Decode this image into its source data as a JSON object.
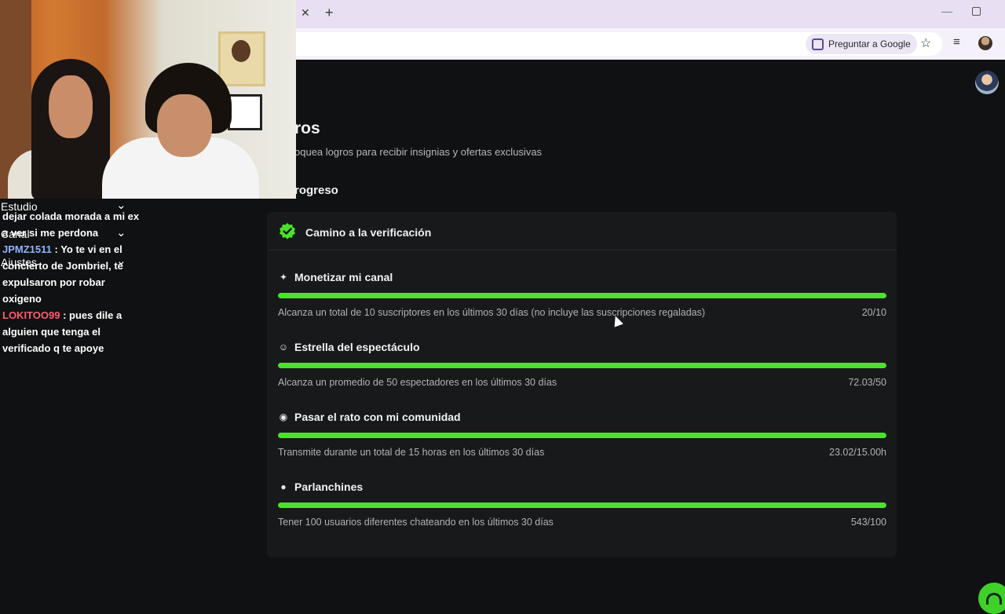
{
  "browser": {
    "ask_google": "Preguntar a Google"
  },
  "page": {
    "title": "ros",
    "subtitle": "oquea logros para recibir insignias y ofertas exclusivas",
    "section_title": "rogreso"
  },
  "card": {
    "title": "Camino a la verificación",
    "achievements": [
      {
        "icon": "sparkle-icon",
        "glyph": "✦",
        "name": "Monetizar mi canal",
        "description": "Alcanza un total de 10 suscriptores en los últimos 30 días (no incluye las suscripciones regaladas)",
        "value": "20/10",
        "progress": 1.0
      },
      {
        "icon": "viewers-icon",
        "glyph": "☺",
        "name": "Estrella del espectáculo",
        "description": "Alcanza un promedio de 50 espectadores en los últimos 30 días",
        "value": "72.03/50",
        "progress": 1.0
      },
      {
        "icon": "broadcast-icon",
        "glyph": "◉",
        "name": "Pasar el rato con mi comunidad",
        "description": "Transmite durante un total de 15 horas en los últimos 30 días",
        "value": "23.02/15.00h",
        "progress": 1.0
      },
      {
        "icon": "chat-bubble-icon",
        "glyph": "●",
        "name": "Parlanchines",
        "description": "Tener 100 usuarios diferentes chateando en los últimos 30 días",
        "value": "543/100",
        "progress": 1.0
      }
    ]
  },
  "overlay": {
    "studio_rows": [
      "Estudio",
      "Canal",
      "Ajustes"
    ],
    "chat": [
      {
        "user": "",
        "text": "dejar colada morada a mi ex"
      },
      {
        "user": "",
        "text": "a ver si me perdona"
      },
      {
        "user": "JPMZ1511",
        "text": ": Yo te vi en el concierto de Jombriel, te expulsaron por robar oxigeno"
      },
      {
        "user": "LOKITOO99",
        "text": ": pues dile a alguien que tenga el verificado q te apoye"
      }
    ]
  },
  "colors": {
    "accent": "#4be22d",
    "background": "#0f1112",
    "card": "#18191b"
  }
}
